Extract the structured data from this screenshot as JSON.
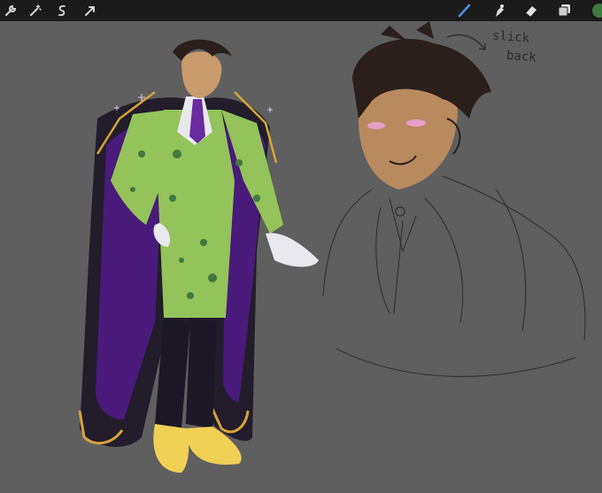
{
  "toolbar": {
    "left_icons": [
      "wrench-icon",
      "magic-wand-icon",
      "selection-icon",
      "transform-arrow-icon"
    ],
    "right_icons": [
      "brush-icon",
      "smudge-icon",
      "eraser-icon",
      "layers-icon"
    ],
    "active_tool": "brush-icon",
    "current_color": "#3f7a3f",
    "brush_active_color": "#4a8fe0"
  },
  "canvas": {
    "background": "#5f5f5f",
    "annotation_line1": "slick",
    "annotation_line2": "back"
  }
}
